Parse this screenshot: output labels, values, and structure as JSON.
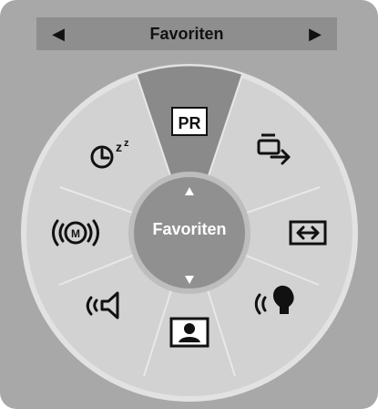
{
  "header": {
    "title": "Favoriten",
    "prev_icon": "triangle-left-icon",
    "next_icon": "triangle-right-icon"
  },
  "center": {
    "label": "Favoriten",
    "up_icon": "arrow-up-icon",
    "down_icon": "arrow-down-icon"
  },
  "menu": {
    "items": [
      {
        "name": "pr-icon",
        "label": "PR",
        "selected": true
      },
      {
        "name": "exit-icon"
      },
      {
        "name": "aspect-ratio-icon"
      },
      {
        "name": "voice-icon"
      },
      {
        "name": "picture-mode-icon"
      },
      {
        "name": "sound-icon"
      },
      {
        "name": "signal-icon"
      },
      {
        "name": "sleep-timer-icon"
      }
    ]
  },
  "colors": {
    "panel": "#a8a8a8",
    "ring": "#cfcfcf",
    "selected_sector": "#8a8a8a",
    "center": "#8f8f8f",
    "text_on_center": "#ffffff",
    "icon": "#111111"
  }
}
